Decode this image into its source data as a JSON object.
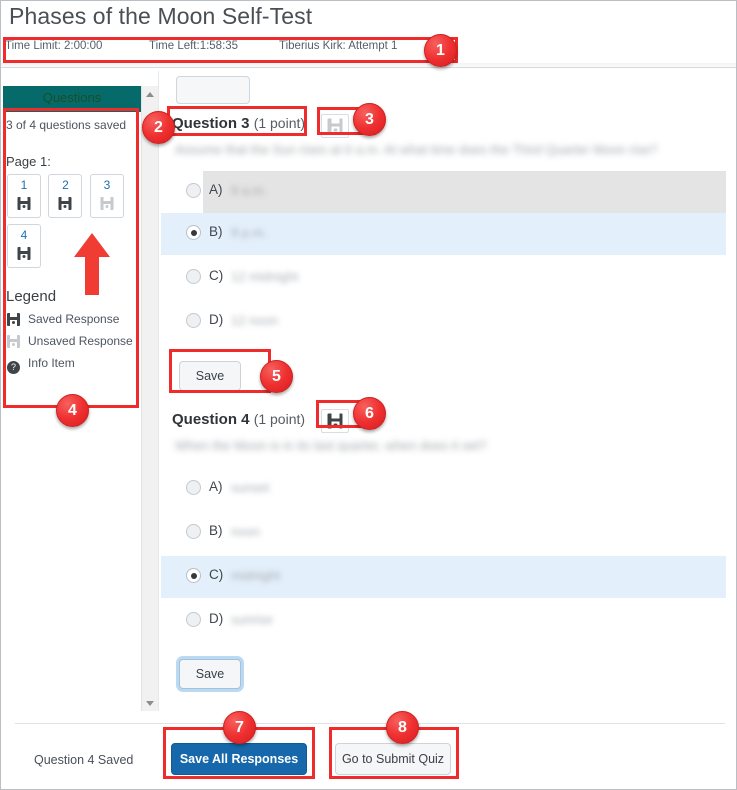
{
  "header": {
    "title": "Phases of the Moon Self-Test",
    "time_limit": "Time Limit: 2:00:00",
    "time_left": "Time Left:1:58:35",
    "attempt": "Tiberius Kirk: Attempt 1"
  },
  "sidebar": {
    "panel_title": "Questions",
    "saved_count": "3 of 4 questions saved",
    "page_label": "Page 1:",
    "tiles": [
      {
        "number": "1",
        "state": "saved"
      },
      {
        "number": "2",
        "state": "saved"
      },
      {
        "number": "3",
        "state": "unsaved"
      },
      {
        "number": "4",
        "state": "saved"
      }
    ],
    "legend_title": "Legend",
    "legend": [
      {
        "icon": "save-disk-dark-icon",
        "label": "Saved Response"
      },
      {
        "icon": "save-disk-grey-icon",
        "label": "Unsaved Response"
      },
      {
        "icon": "question-mark-icon",
        "label": "Info Item"
      }
    ]
  },
  "questions": [
    {
      "heading": "Question 3",
      "points": "(1 point)",
      "save_state": "unsaved",
      "prompt": "Assume that the Sun rises at 6 a.m. At what time does the Third Quarter Moon rise?",
      "options": [
        {
          "letter": "A)",
          "value": "9 a.m.",
          "selected": false,
          "highlight": "hover"
        },
        {
          "letter": "B)",
          "value": "9 p.m.",
          "selected": true,
          "highlight": "selected"
        },
        {
          "letter": "C)",
          "value": "12 midnight",
          "selected": false,
          "highlight": "none"
        },
        {
          "letter": "D)",
          "value": "12 noon",
          "selected": false,
          "highlight": "none"
        }
      ],
      "save_label": "Save"
    },
    {
      "heading": "Question 4",
      "points": "(1 point)",
      "save_state": "saved",
      "prompt": "When the Moon is in its last quarter, when does it set?",
      "options": [
        {
          "letter": "A)",
          "value": "sunset",
          "selected": false,
          "highlight": "none"
        },
        {
          "letter": "B)",
          "value": "noon",
          "selected": false,
          "highlight": "none"
        },
        {
          "letter": "C)",
          "value": "midnight",
          "selected": true,
          "highlight": "selected"
        },
        {
          "letter": "D)",
          "value": "sunrise",
          "selected": false,
          "highlight": "none"
        }
      ],
      "save_label": "Save"
    }
  ],
  "footer": {
    "status": "Question 4 Saved",
    "save_all_label": "Save All Responses",
    "submit_label": "Go to Submit Quiz"
  },
  "annotations": [
    {
      "number": "1"
    },
    {
      "number": "2"
    },
    {
      "number": "3"
    },
    {
      "number": "4"
    },
    {
      "number": "5"
    },
    {
      "number": "6"
    },
    {
      "number": "7"
    },
    {
      "number": "8"
    }
  ],
  "colors": {
    "accent_red": "#ef2b2b",
    "teal": "#076a6a",
    "primary_blue": "#1668ab",
    "selected_row": "#e3effa",
    "hover_row": "#e4e4e4"
  }
}
